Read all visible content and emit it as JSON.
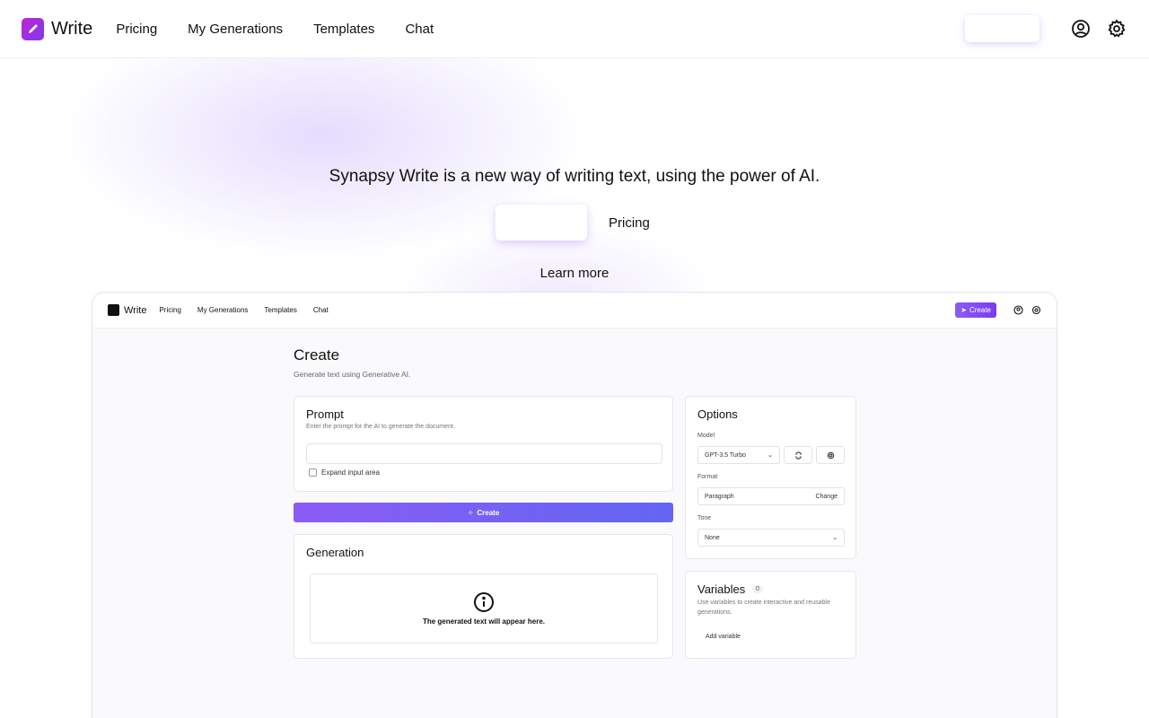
{
  "nav": {
    "brand": "Write",
    "links": [
      "Pricing",
      "My Generations",
      "Templates",
      "Chat"
    ],
    "create_label": "",
    "icons": [
      "account-circle-icon",
      "settings-gear-icon"
    ]
  },
  "hero": {
    "title": "Synapsy Write is a new way of writing text, using the power of AI.",
    "primary_label": "",
    "pricing_label": "Pricing",
    "learn_more": "Learn more"
  },
  "preview": {
    "nav": {
      "brand": "Write",
      "links": [
        "Pricing",
        "My Generations",
        "Templates",
        "Chat"
      ],
      "create_label": "Create"
    },
    "page_title": "Create",
    "page_subtitle": "Generate text using Generative AI.",
    "prompt": {
      "title": "Prompt",
      "description": "Enter the prompt for the AI to generate the document.",
      "input_value": "",
      "expand_label": "Expand input area"
    },
    "create_button": "Create",
    "generation": {
      "title": "Generation",
      "empty_text": "The generated text will appear here."
    },
    "options": {
      "title": "Options",
      "model_label": "Model",
      "model_value": "GPT-3.5 Turbo",
      "format_label": "Format",
      "format_value": "Paragraph",
      "format_change": "Change",
      "tone_label": "Tone",
      "tone_value": "None"
    },
    "variables": {
      "title": "Variables",
      "count": "0",
      "description": "Use variables to create interactive and reusable generations.",
      "add_label": "Add variable"
    }
  },
  "colors": {
    "accent": "#7c3aed",
    "accent_light": "#8b5cf6",
    "brand_gradient_start": "#c026d3"
  }
}
